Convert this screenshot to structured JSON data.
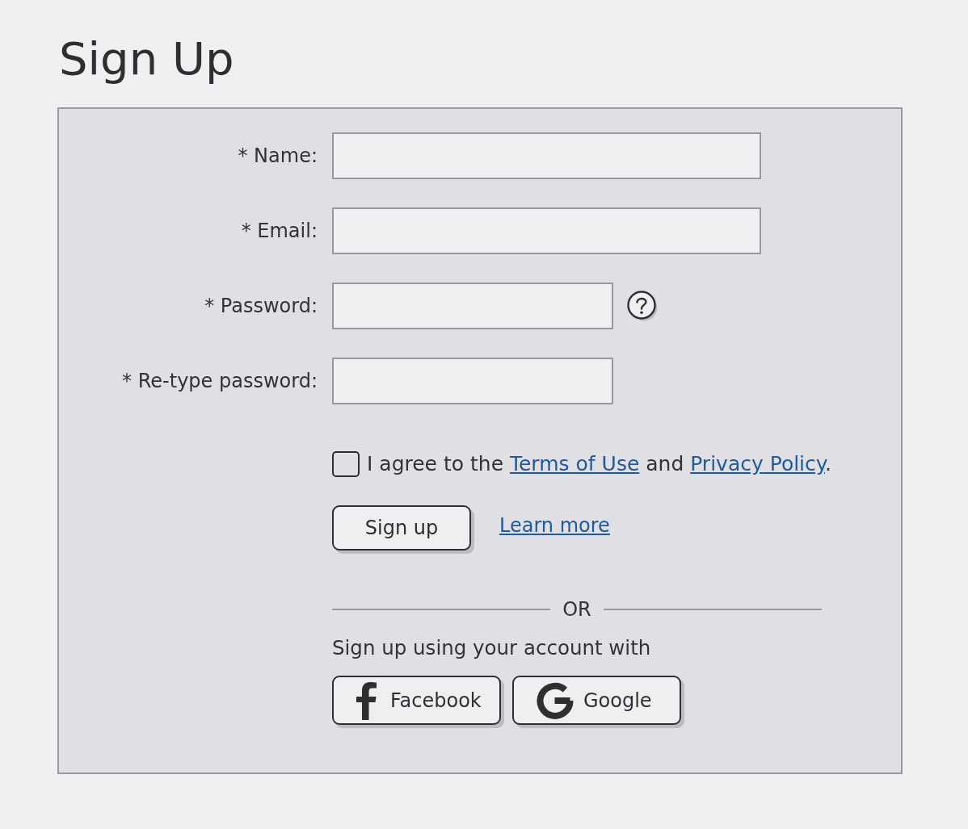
{
  "title": "Sign Up",
  "fields": [
    {
      "label": "* Name:",
      "kind": "text",
      "help": false
    },
    {
      "label": "* Email:",
      "kind": "text",
      "help": false
    },
    {
      "label": "* Password:",
      "kind": "password",
      "help": true
    },
    {
      "label": "* Re-type password:",
      "kind": "password",
      "help": false
    }
  ],
  "agreement": {
    "checked": false,
    "parts": [
      {
        "kind": "text",
        "text": "I agree to the "
      },
      {
        "kind": "link",
        "text": "Terms of Use"
      },
      {
        "kind": "text",
        "text": " and "
      },
      {
        "kind": "link",
        "text": "Privacy Policy"
      },
      {
        "kind": "text",
        "text": "."
      }
    ]
  },
  "submit_button": "Sign up",
  "learn_more_link": "Learn more",
  "divider_label": "OR",
  "social_prompt": "Sign up using your account with",
  "social_buttons": [
    {
      "kind": "facebook",
      "label": "Facebook"
    },
    {
      "kind": "google",
      "label": "Google"
    }
  ]
}
